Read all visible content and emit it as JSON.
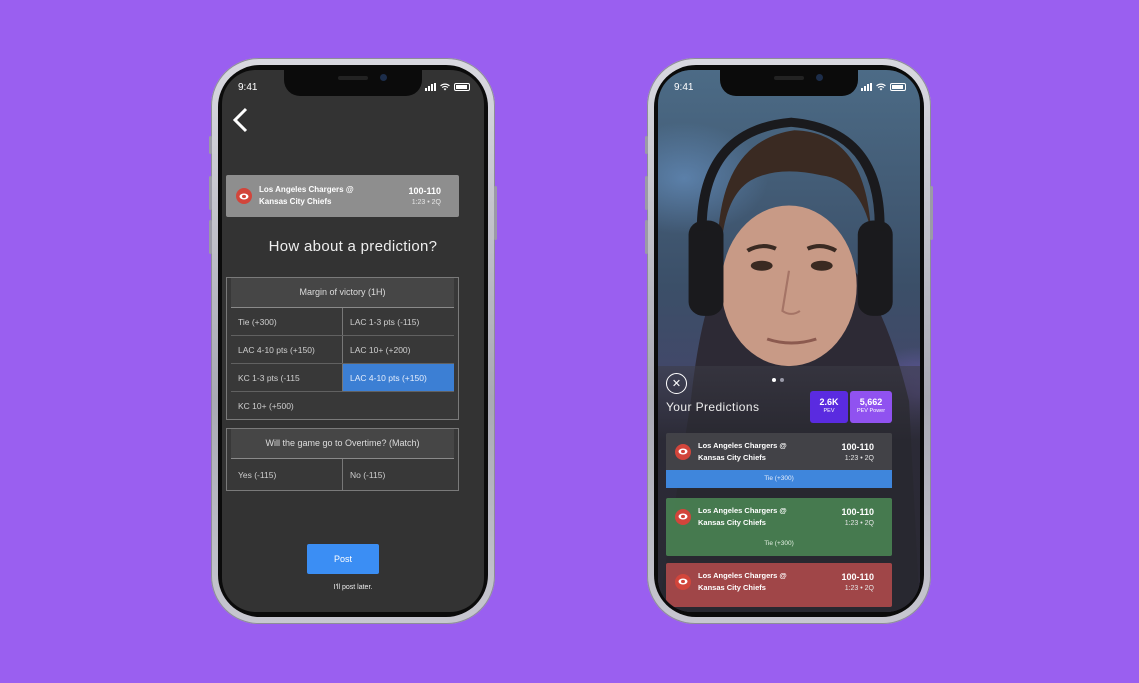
{
  "left_phone": {
    "status_time": "9:41",
    "game": {
      "teams_line1": "Los Angeles Chargers @",
      "teams_line2": "Kansas City Chiefs",
      "score": "100-110",
      "time": "1:23 • 2Q"
    },
    "question": "How about a prediction?",
    "margin_panel": {
      "title": "Margin of victory (1H)",
      "rows": [
        [
          "Tie (+300)",
          "LAC 1-3 pts (-115)"
        ],
        [
          "LAC 4-10 pts (+150)",
          "LAC 10+ (+200)"
        ],
        [
          "KC 1-3 pts (-115",
          "LAC 4-10 pts (+150)"
        ],
        [
          "KC 10+ (+500)",
          ""
        ]
      ],
      "selected": [
        2,
        1
      ]
    },
    "overtime_panel": {
      "title": "Will the game go to Overtime? (Match)",
      "options": [
        "Yes (-115)",
        "No (-115)"
      ]
    },
    "post_label": "Post",
    "later_label": "I'll post later.",
    "accent": "#3b8ef4"
  },
  "right_phone": {
    "status_time": "9:41",
    "title": "Your Predictions",
    "stats": [
      {
        "value": "2.6K",
        "label": "PEV",
        "color": "#5a2be0"
      },
      {
        "value": "5,662",
        "label": "PEV Power",
        "color": "#9052f0"
      }
    ],
    "cards": [
      {
        "teams_line1": "Los Angeles Chargers @",
        "teams_line2": "Kansas City Chiefs",
        "score": "100-110",
        "time": "1:23 • 2Q",
        "pick": "Tie (+300)"
      },
      {
        "teams_line1": "Los Angeles Chargers @",
        "teams_line2": "Kansas City Chiefs",
        "score": "100-110",
        "time": "1:23 • 2Q",
        "pick": "Tie (+300)"
      },
      {
        "teams_line1": "Los Angeles Chargers @",
        "teams_line2": "Kansas City Chiefs",
        "score": "100-110",
        "time": "1:23 • 2Q"
      }
    ]
  }
}
